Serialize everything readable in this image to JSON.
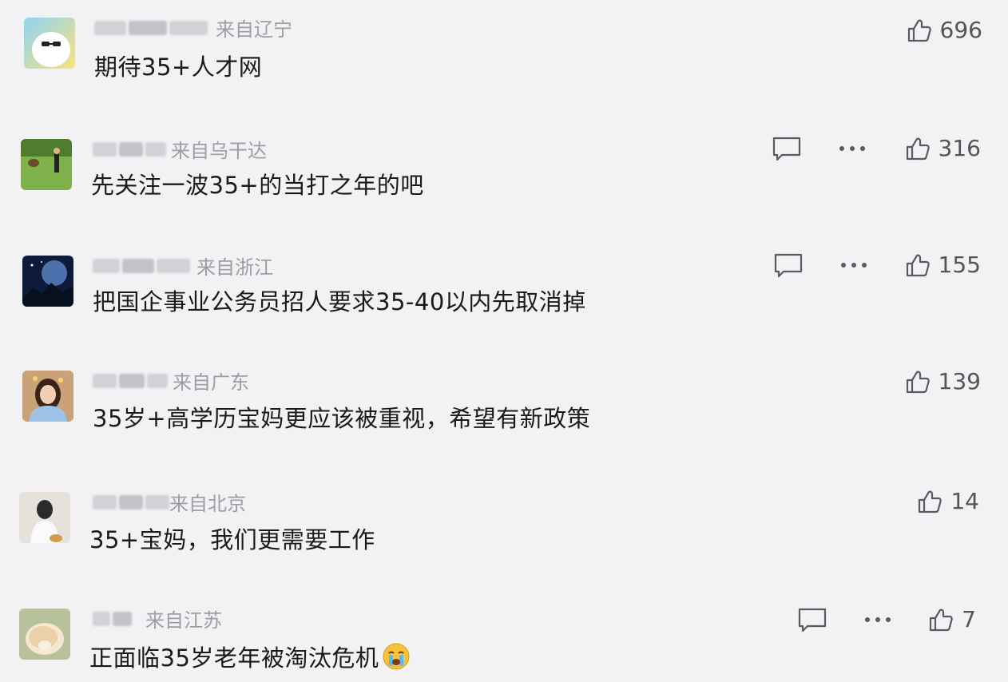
{
  "comments": [
    {
      "location": "来自辽宁",
      "text": "期待35+人才网",
      "likes": "696",
      "show_actions": false
    },
    {
      "location": "来自乌干达",
      "text": "先关注一波35+的当打之年的吧",
      "likes": "316",
      "show_actions": true
    },
    {
      "location": "来自浙江",
      "text": "把国企事业公务员招人要求35-40以内先取消掉",
      "likes": "155",
      "show_actions": true
    },
    {
      "location": "来自广东",
      "text": "35岁+高学历宝妈更应该被重视，希望有新政策",
      "likes": "139",
      "show_actions": false
    },
    {
      "location": "来自北京",
      "text": "35+宝妈，我们更需要工作",
      "likes": "14",
      "show_actions": false
    },
    {
      "location": "来自江苏",
      "text": "正面临35岁老年被淘汰危机",
      "likes": "7",
      "show_actions": true,
      "emoji": "crying-face-emoji"
    }
  ],
  "icons": {
    "like": "thumbs-up-icon",
    "reply": "comment-bubble-icon",
    "more": "more-dots-icon"
  },
  "colors": {
    "background": "#f2f2f4",
    "text": "#1a1a1a",
    "meta": "#9d9da3",
    "icon": "#5a5a60"
  }
}
